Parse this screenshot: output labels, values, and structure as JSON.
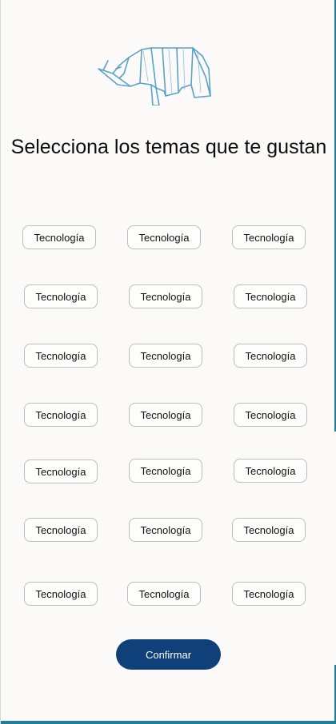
{
  "title": "Selecciona los temas que te gustan",
  "logo_icon": "origami-rhinoceros-icon",
  "colors": {
    "accent": "#0f4079",
    "logo_stroke": "#5aa2c8",
    "frame_edge": "#1f7f9a"
  },
  "topics": [
    {
      "label": "Tecnología"
    },
    {
      "label": "Tecnología"
    },
    {
      "label": "Tecnología"
    },
    {
      "label": "Tecnología"
    },
    {
      "label": "Tecnología"
    },
    {
      "label": "Tecnología"
    },
    {
      "label": "Tecnología"
    },
    {
      "label": "Tecnología"
    },
    {
      "label": "Tecnología"
    },
    {
      "label": "Tecnología"
    },
    {
      "label": "Tecnología"
    },
    {
      "label": "Tecnología"
    },
    {
      "label": "Tecnología"
    },
    {
      "label": "Tecnología"
    },
    {
      "label": "Tecnología"
    },
    {
      "label": "Tecnología"
    },
    {
      "label": "Tecnología"
    },
    {
      "label": "Tecnología"
    },
    {
      "label": "Tecnología"
    },
    {
      "label": "Tecnología"
    },
    {
      "label": "Tecnología"
    }
  ],
  "confirm_label": "Confirmar"
}
